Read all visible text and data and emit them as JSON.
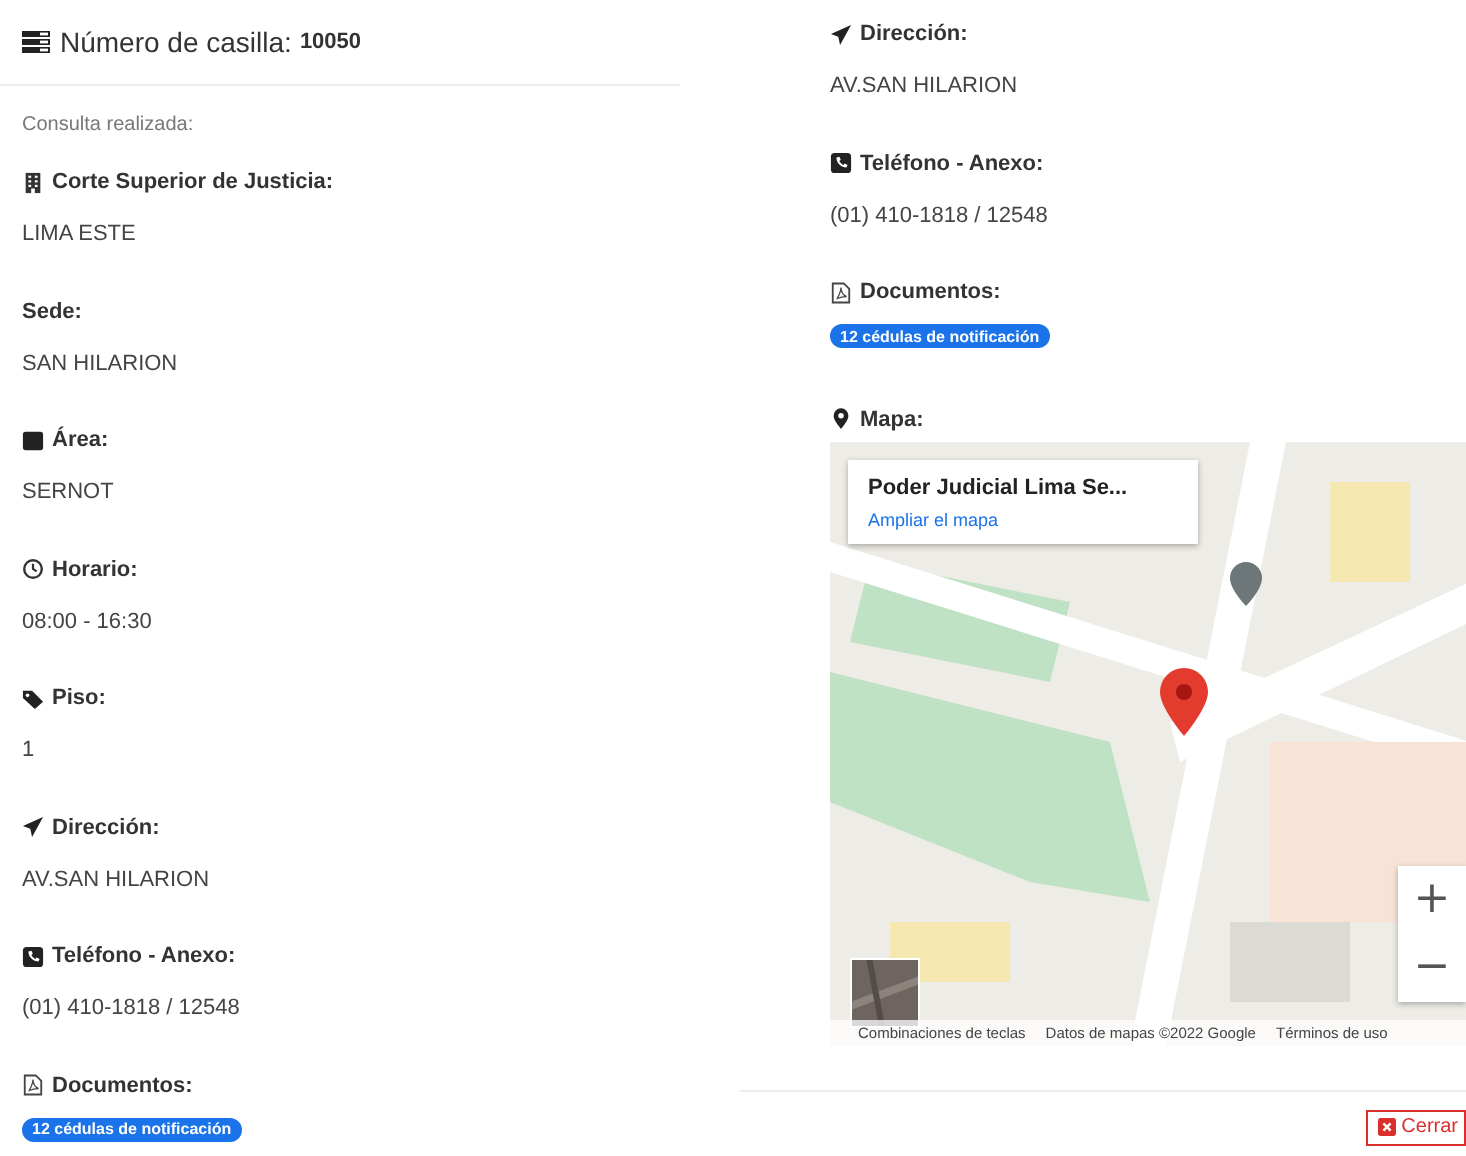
{
  "header": {
    "label": "Número de casilla:",
    "value": "10050"
  },
  "subtitle": "Consulta realizada:",
  "left_fields": [
    {
      "kind": "building",
      "label": "Corte Superior de Justicia:",
      "value": "LIMA ESTE"
    },
    {
      "kind": "plain",
      "label": "Sede:",
      "value": "SAN HILARION"
    },
    {
      "kind": "square",
      "label": "Área:",
      "value": "SERNOT"
    },
    {
      "kind": "clock",
      "label": "Horario:",
      "value": "08:00 - 16:30"
    },
    {
      "kind": "tag",
      "label": "Piso:",
      "value": "1"
    },
    {
      "kind": "send",
      "label": "Dirección:",
      "value": "AV.SAN HILARION"
    },
    {
      "kind": "phone",
      "label": "Teléfono - Anexo:",
      "value": "(01) 410-1818 / 12548"
    },
    {
      "kind": "pdf",
      "label": "Documentos:",
      "badge": "12 cédulas de notificación"
    }
  ],
  "right_fields": [
    {
      "kind": "send",
      "label": "Dirección:",
      "value": "AV.SAN HILARION"
    },
    {
      "kind": "phone",
      "label": "Teléfono - Anexo:",
      "value": "(01) 410-1818 / 12548"
    },
    {
      "kind": "pdf",
      "label": "Documentos:",
      "badge": "12 cédulas de notificación"
    }
  ],
  "map": {
    "kind": "pin",
    "label": "Mapa:",
    "place_title": "Poder Judicial Lima Se...",
    "link": "Ampliar el mapa",
    "zoom_in": "+",
    "zoom_out": "−",
    "attribution": [
      "Combinaciones de teclas",
      "Datos de mapas ©2022 Google",
      "Términos de uso"
    ]
  },
  "close_button": "Cerrar"
}
